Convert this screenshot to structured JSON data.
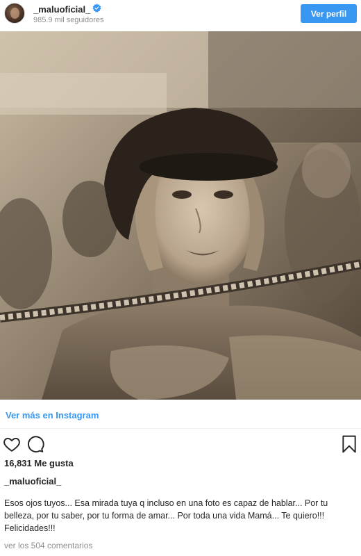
{
  "header": {
    "username": "_maluoficial_",
    "verified_icon": "verified-badge-icon",
    "followers": "985.9 mil seguidores",
    "view_profile_label": "Ver perfil",
    "accent": "#3897f0"
  },
  "post": {
    "image_icon": "sepia-portrait-photo"
  },
  "links": {
    "view_on_instagram": "Ver más en Instagram"
  },
  "actions": {
    "like_icon": "heart-icon",
    "comment_icon": "comment-bubble-icon",
    "save_icon": "bookmark-icon"
  },
  "stats": {
    "likes": "16,831 Me gusta"
  },
  "caption": {
    "username": "_maluoficial_",
    "text": "Esos ojos tuyos... Esa mirada tuya q incluso en una foto es capaz de hablar... Por tu belleza, por tu saber, por tu forma de amar... Por toda una vida Mamá... Te quiero!!! Felicidades!!!"
  },
  "comments": {
    "view_all": "ver los 504 comentarios"
  }
}
